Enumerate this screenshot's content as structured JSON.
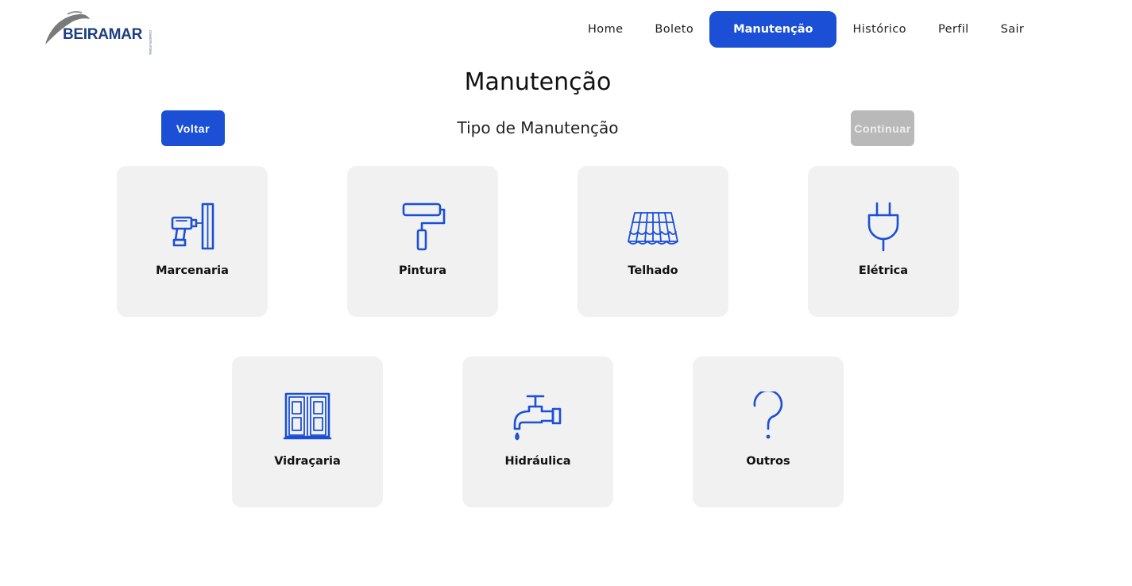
{
  "header": {
    "logo_text": "BEIRAMAR",
    "logo_sub": "CONSTRUTORA",
    "nav": [
      {
        "label": "Home",
        "active": false
      },
      {
        "label": "Boleto",
        "active": false
      },
      {
        "label": "Manutenção",
        "active": true
      },
      {
        "label": "Histórico",
        "active": false
      },
      {
        "label": "Perfil",
        "active": false
      },
      {
        "label": "Sair",
        "active": false
      }
    ]
  },
  "main": {
    "title": "Manutenção",
    "subtitle": "Tipo de Manutenção",
    "back_label": "Voltar",
    "continue_label": "Continuar",
    "categories": [
      {
        "label": "Marcenaria",
        "icon": "drill-icon"
      },
      {
        "label": "Pintura",
        "icon": "paint-roller-icon"
      },
      {
        "label": "Telhado",
        "icon": "roof-tiles-icon"
      },
      {
        "label": "Elétrica",
        "icon": "plug-icon"
      },
      {
        "label": "Vidraçaria",
        "icon": "window-icon"
      },
      {
        "label": "Hidráulica",
        "icon": "faucet-icon"
      },
      {
        "label": "Outros",
        "icon": "question-icon"
      }
    ]
  },
  "colors": {
    "primary": "#1a4fd6",
    "disabled": "#b9b9b9",
    "card_bg": "#f1f1f1",
    "logo": "#1c3f82"
  }
}
